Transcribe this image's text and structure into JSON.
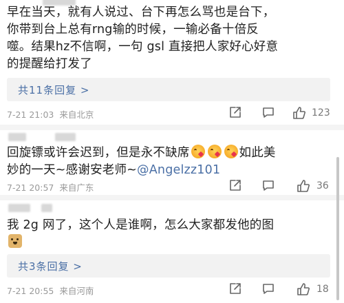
{
  "comments": [
    {
      "lines": [
        "早在当天，就有人说过、台下再怎么骂也是台下，",
        "你带到台上总有rng输的时候，一输必备十倍反",
        "噬。结果hz不信啊，一句 gsl 直接把人家好心好意",
        "的提醒给打发了"
      ],
      "reply_label": "共11条回复 >",
      "time": "7-21 21:03",
      "location": "来自北京",
      "like_count": "123"
    },
    {
      "line1": "回旋镖或许会迟到，但是永不缺席",
      "line1_tail": "如此美",
      "line2_prefix": "妙的一天~感谢安老师~",
      "mention": "@Angelzz101",
      "time": "7-21 20:57",
      "location": "来自广东",
      "like_count": "36"
    },
    {
      "line1": "我 2g 网了，这个人是谁啊，怎么大家都发他的图",
      "reply_label": "共3条回复 >",
      "time": "7-21 20:55",
      "location": "来自河南",
      "like_count": "18"
    }
  ],
  "icons": {
    "share": "share-icon",
    "comment": "comment-icon",
    "like": "thumbs-up-icon",
    "emoji_kiss": "face-blowing-kiss-emoji",
    "emoji_doge": "doge-emoji"
  },
  "colors": {
    "link": "#4a6fa5",
    "meta": "#999999",
    "text": "#222222",
    "reply_bg": "#f2f2f2"
  }
}
